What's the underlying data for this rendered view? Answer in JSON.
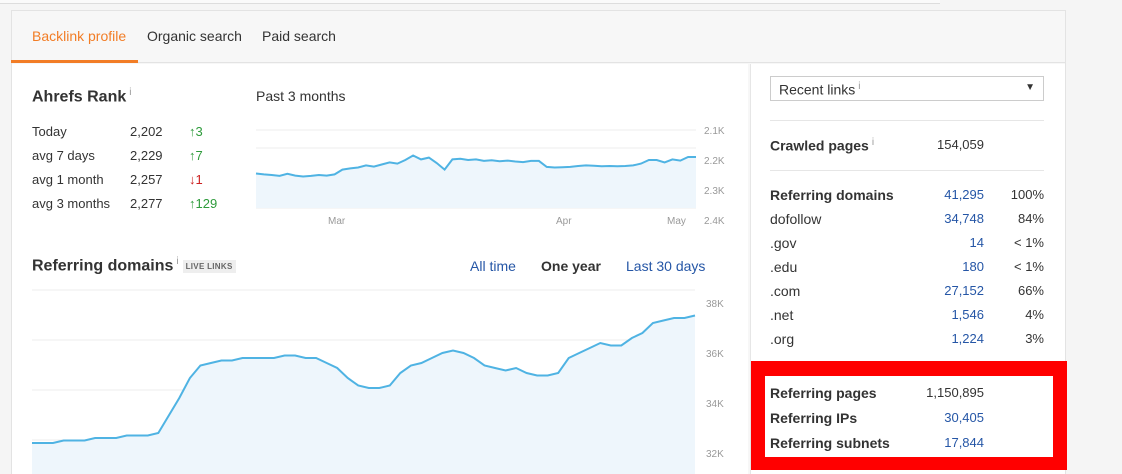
{
  "tabs": [
    {
      "label": "Backlink profile",
      "active": true
    },
    {
      "label": "Organic search",
      "active": false
    },
    {
      "label": "Paid search",
      "active": false
    }
  ],
  "ahrefs_rank": {
    "title": "Ahrefs Rank",
    "info": "i",
    "rows": [
      {
        "label": "Today",
        "value": "2,202",
        "change": "3",
        "dir": "up"
      },
      {
        "label": "avg 7 days",
        "value": "2,229",
        "change": "7",
        "dir": "up"
      },
      {
        "label": "avg 1 month",
        "value": "2,257",
        "change": "1",
        "dir": "down"
      },
      {
        "label": "avg 3 months",
        "value": "2,277",
        "change": "129",
        "dir": "up"
      }
    ],
    "period_label": "Past 3 months"
  },
  "rank_chart": {
    "y_ticks": [
      "2.1K",
      "2.2K",
      "2.3K",
      "2.4K"
    ],
    "x_ticks": [
      "Mar",
      "Apr",
      "May"
    ]
  },
  "referring_domains_section": {
    "title": "Referring domains",
    "info": "i",
    "badge": "LIVE LINKS",
    "periods": [
      {
        "label": "All time",
        "selected": false
      },
      {
        "label": "One year",
        "selected": true
      },
      {
        "label": "Last 30 days",
        "selected": false
      }
    ],
    "y_ticks": [
      "38K",
      "36K",
      "34K",
      "32K"
    ]
  },
  "right": {
    "dropdown": {
      "label": "Recent links",
      "info": "i"
    },
    "crawled": {
      "label": "Crawled pages",
      "info": "i",
      "value": "154,059"
    },
    "domains": [
      {
        "label": "Referring domains",
        "value": "41,295",
        "pct": "100%",
        "bold": true
      },
      {
        "label": "dofollow",
        "value": "34,748",
        "pct": "84%"
      },
      {
        "label": ".gov",
        "value": "14",
        "pct": "< 1%"
      },
      {
        "label": ".edu",
        "value": "180",
        "pct": "< 1%"
      },
      {
        "label": ".com",
        "value": "27,152",
        "pct": "66%"
      },
      {
        "label": ".net",
        "value": "1,546",
        "pct": "4%"
      },
      {
        "label": ".org",
        "value": "1,224",
        "pct": "3%"
      }
    ],
    "highlight": [
      {
        "label": "Referring pages",
        "value": "1,150,895",
        "link": false
      },
      {
        "label": "Referring IPs",
        "value": "30,405",
        "link": true
      },
      {
        "label": "Referring subnets",
        "value": "17,844",
        "link": true
      }
    ]
  },
  "colors": {
    "accent": "#f27d26",
    "link": "#2556a6",
    "line": "#4fb3e3",
    "fill": "#eef6fc",
    "highlight": "#ff0000"
  },
  "chart_data": [
    {
      "type": "line",
      "series": [
        {
          "values": [
            2245,
            2248,
            2250,
            2253,
            2246,
            2252,
            2255,
            2253,
            2250,
            2252,
            2248,
            2232,
            2228,
            2225,
            2218,
            2222,
            2215,
            2208,
            2212,
            2200,
            2185,
            2198,
            2192,
            2210,
            2232,
            2198,
            2196,
            2200,
            2198,
            2203,
            2201,
            2204,
            2202,
            2205,
            2207,
            2203,
            2203,
            2223,
            2225,
            2224,
            2223,
            2220,
            2218,
            2219,
            2221,
            2220,
            2221,
            2220,
            2218,
            2212,
            2200,
            2200,
            2208,
            2198,
            2202,
            2190,
            2190
          ]
        }
      ],
      "ylim": [
        2100,
        2400
      ],
      "y_reversed": true
    },
    {
      "type": "area",
      "series": [
        {
          "values": [
            32.4,
            32.4,
            32.4,
            32.5,
            32.5,
            32.5,
            32.6,
            32.6,
            32.6,
            32.7,
            32.7,
            32.7,
            32.8,
            33.5,
            34.2,
            35.0,
            35.5,
            35.6,
            35.7,
            35.7,
            35.8,
            35.8,
            35.8,
            35.8,
            35.9,
            35.9,
            35.8,
            35.8,
            35.6,
            35.4,
            35.0,
            34.7,
            34.6,
            34.6,
            34.7,
            35.2,
            35.5,
            35.6,
            35.8,
            36.0,
            36.1,
            36.0,
            35.8,
            35.5,
            35.4,
            35.3,
            35.4,
            35.2,
            35.1,
            35.1,
            35.2,
            35.8,
            36.0,
            36.2,
            36.4,
            36.3,
            36.3,
            36.6,
            36.8,
            37.2,
            37.3,
            37.4,
            37.4,
            37.5
          ]
        }
      ],
      "ylim": [
        32,
        38
      ]
    }
  ]
}
